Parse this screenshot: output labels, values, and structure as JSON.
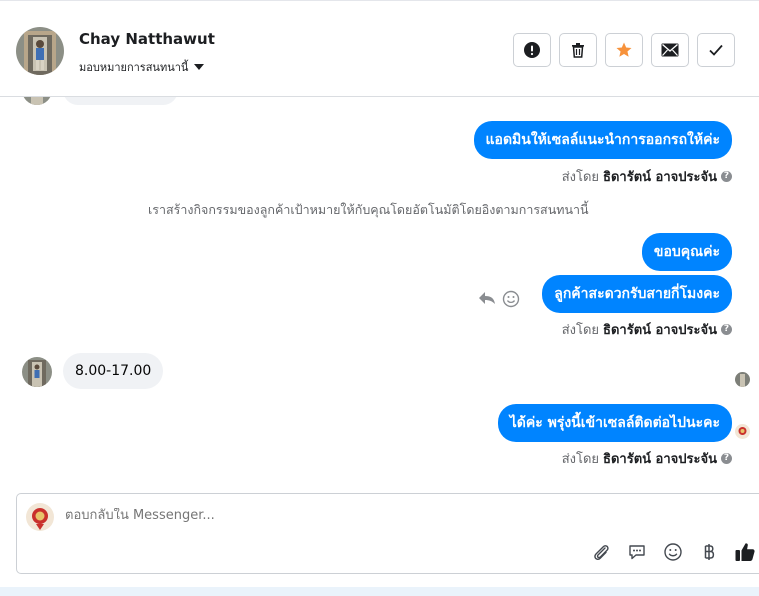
{
  "header": {
    "contact_name": "Chay Natthawut",
    "assign_label": "มอบหมายการสนทนานี้",
    "actions": [
      {
        "name": "mark-spam",
        "icon": "exclamation-icon"
      },
      {
        "name": "delete",
        "icon": "trash-icon"
      },
      {
        "name": "follow-up",
        "icon": "star-icon",
        "color": "#f7923b"
      },
      {
        "name": "mark-unread",
        "icon": "envelope-icon"
      },
      {
        "name": "mark-done",
        "icon": "checkmark-icon"
      }
    ]
  },
  "messages": {
    "m1": "แอดมินให้เซลล์แนะนำการออกรถให้ค่ะ",
    "sent_by_prefix": "ส่งโดย",
    "sender": "ธิดารัตน์ อาจประจัน",
    "system_note": "เราสร้างกิจกรรมของลูกค้าเป้าหมายให้กับคุณโดยอัตโนมัติโดยอิงตามการสนทนานี้",
    "m2": "ขอบคุณค่ะ",
    "m3": "ลูกค้าสะดวกรับสายกี่โมงคะ",
    "m4_incoming": "8.00-17.00",
    "m5": "ได้ค่ะ พรุ่งนี้เข้าเซลล์ติดต่อไปนะคะ"
  },
  "composer": {
    "placeholder": "ตอบกลับใน Messenger...",
    "tools": [
      "paperclip-icon",
      "saved-reply-icon",
      "emoji-icon",
      "baht-icon",
      "thumbs-up-icon"
    ]
  },
  "colors": {
    "accent": "#0084ff",
    "incoming_bubble": "#f0f2f5",
    "star": "#f7923b"
  }
}
